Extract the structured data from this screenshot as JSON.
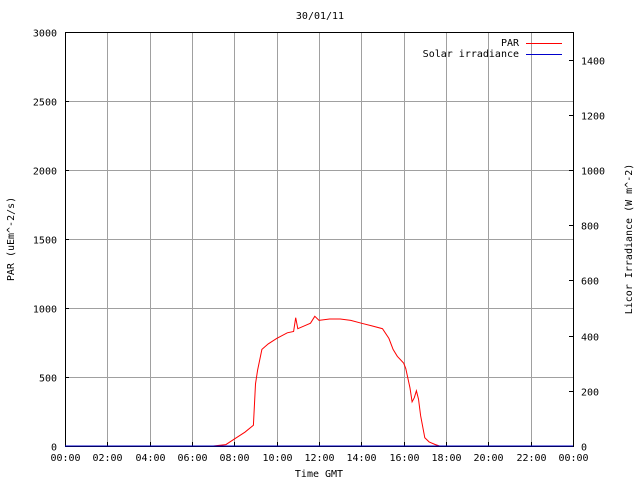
{
  "chart_data": {
    "type": "line",
    "title": "30/01/11",
    "xlabel": "Time GMT",
    "ylabel_left": "PAR (uEm^-2/s)",
    "ylabel_right": "Licor Irradiance (W m^-2)",
    "xlim": [
      0,
      24
    ],
    "ylim_left": [
      0,
      3000
    ],
    "ylim_right": [
      0,
      1500
    ],
    "grid": true,
    "legend_placement": "top-right",
    "x_ticks": [
      "00:00",
      "02:00",
      "04:00",
      "06:00",
      "08:00",
      "10:00",
      "12:00",
      "14:00",
      "16:00",
      "18:00",
      "20:00",
      "22:00",
      "00:00"
    ],
    "y_ticks_left": [
      "0",
      "500",
      "1000",
      "1500",
      "2000",
      "2500",
      "3000"
    ],
    "y_ticks_right": [
      "0",
      "200",
      "400",
      "600",
      "800",
      "1000",
      "1200",
      "1400"
    ],
    "series": [
      {
        "name": "PAR",
        "axis": "left",
        "color": "#ff0000",
        "x": [
          0,
          7.0,
          7.6,
          8.0,
          8.5,
          8.9,
          9.0,
          9.1,
          9.3,
          9.6,
          10.0,
          10.5,
          10.8,
          10.9,
          11.0,
          11.3,
          11.6,
          11.8,
          12.0,
          12.5,
          13.0,
          13.5,
          14.0,
          14.5,
          15.0,
          15.3,
          15.5,
          15.7,
          16.0,
          16.1,
          16.3,
          16.4,
          16.5,
          16.6,
          16.7,
          16.8,
          17.0,
          17.2,
          17.5,
          17.7,
          24
        ],
        "y": [
          0,
          0,
          10,
          50,
          100,
          150,
          450,
          550,
          700,
          740,
          780,
          820,
          830,
          930,
          850,
          870,
          890,
          940,
          910,
          920,
          920,
          910,
          890,
          870,
          850,
          780,
          700,
          650,
          600,
          560,
          420,
          320,
          350,
          400,
          340,
          220,
          60,
          30,
          10,
          0,
          0
        ]
      },
      {
        "name": "Solar irradiance",
        "axis": "right",
        "color": "#0000cc",
        "x": [
          0,
          24
        ],
        "y": [
          0,
          0
        ]
      }
    ]
  }
}
